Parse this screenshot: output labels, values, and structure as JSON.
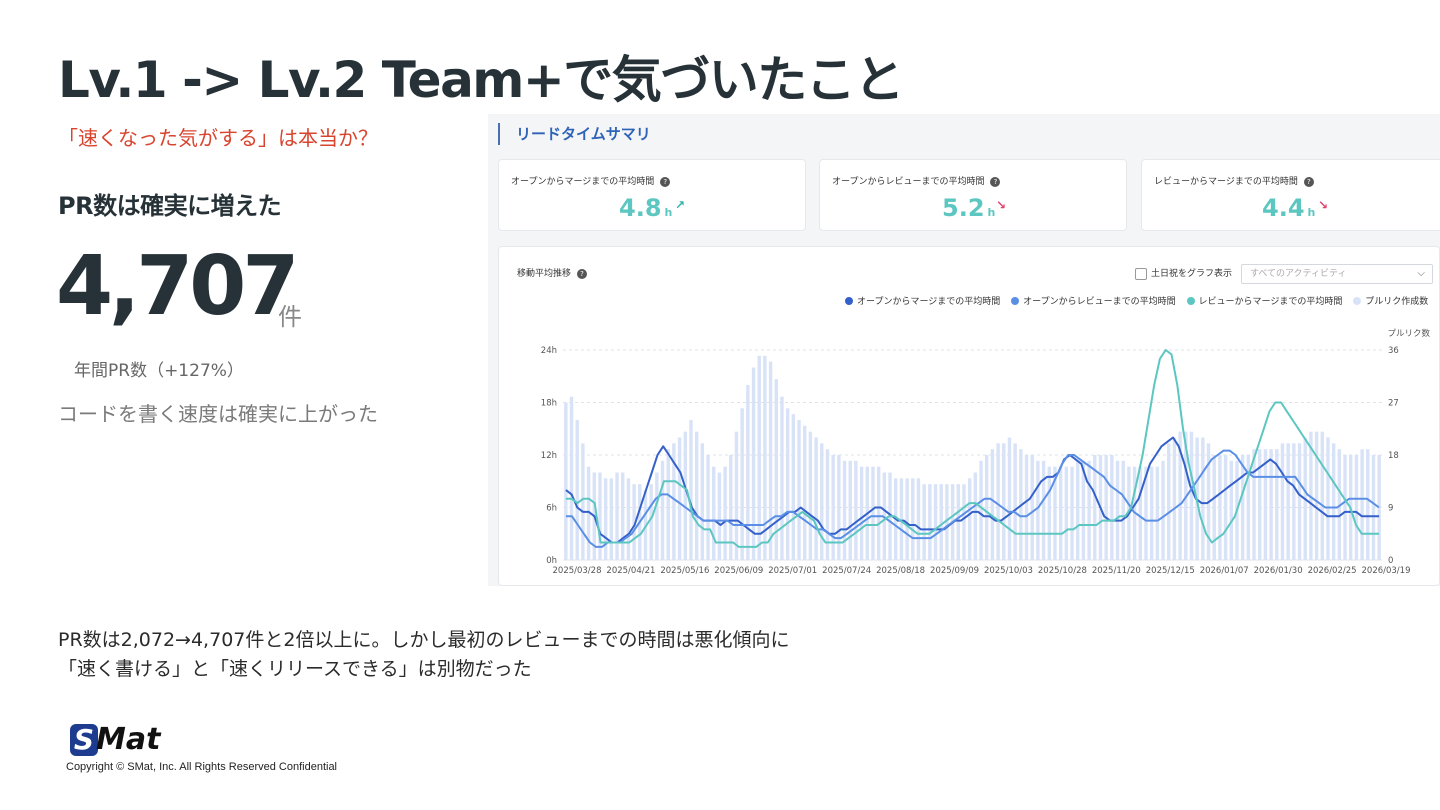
{
  "slide": {
    "title": "Lv.1 -> Lv.2 Team+で気づいたこと",
    "subtitle": "「速くなった気がする」は本当か？",
    "pr_heading": "PR数は確実に増えた",
    "pr_count": "4,707",
    "pr_unit": "件",
    "pr_caption": "年間PR数（+127%）",
    "speed_note": "コードを書く速度は確実に上がった",
    "footnote_line1": "PR数は2,072→4,707件と2倍以上に。しかし最初のレビューまでの時間は悪化傾向に",
    "footnote_line2": "「速く書ける」と「速くリリースできる」は別物だった",
    "logo": "SMat",
    "copyright": "Copyright © SMat, Inc. All Rights Reserved Confidential"
  },
  "dashboard": {
    "panel_title": "リードタイムサマリ",
    "help_icon": "?",
    "metrics": [
      {
        "label": "オープンからマージまでの平均時間",
        "value": "4.8",
        "unit": "h",
        "trend": "↗",
        "trend_color": "#2fb3a8"
      },
      {
        "label": "オープンからレビューまでの平均時間",
        "value": "5.2",
        "unit": "h",
        "trend": "↘",
        "trend_color": "#e0436f"
      },
      {
        "label": "レビューからマージまでの平均時間",
        "value": "4.4",
        "unit": "h",
        "trend": "↘",
        "trend_color": "#e0436f"
      }
    ],
    "chart_title": "移動平均推移",
    "holiday_toggle_label": "土日祝をグラフ表示",
    "activity_select_value": "すべてのアクティビティ",
    "legend": [
      {
        "name": "オープンからマージまでの平均時間",
        "color": "#3460c9"
      },
      {
        "name": "オープンからレビューまでの平均時間",
        "color": "#5b8fe6"
      },
      {
        "name": "レビューからマージまでの平均時間",
        "color": "#5cc6c0"
      },
      {
        "name": "プルリク作成数",
        "color": "#d9e3f7"
      }
    ]
  },
  "chart_data": {
    "type": "line",
    "y_left_ticks": [
      "0h",
      "6h",
      "12h",
      "18h",
      "24h"
    ],
    "y_left_range": [
      0,
      24
    ],
    "y_right_label": "プルリク数",
    "y_right_ticks": [
      "0",
      "9",
      "18",
      "27",
      "36"
    ],
    "y_right_range": [
      0,
      36
    ],
    "x_tick_labels": [
      "2025/03/28",
      "2025/04/21",
      "2025/05/16",
      "2025/06/09",
      "2025/07/01",
      "2025/07/24",
      "2025/08/18",
      "2025/09/09",
      "2025/10/03",
      "2025/10/28",
      "2025/11/20",
      "2025/12/15",
      "2026/01/07",
      "2026/01/30",
      "2026/02/25",
      "2026/03/19"
    ],
    "grid": true,
    "bar_series": {
      "name": "プルリク作成数",
      "color": "#d9e3f7",
      "axis": "right",
      "values": [
        27,
        28,
        24,
        20,
        16,
        15,
        15,
        14,
        14,
        15,
        15,
        14,
        13,
        13,
        12,
        13,
        15,
        17,
        19,
        20,
        21,
        22,
        24,
        22,
        20,
        18,
        16,
        15,
        16,
        18,
        22,
        26,
        30,
        33,
        35,
        35,
        34,
        31,
        28,
        26,
        25,
        24,
        23,
        22,
        21,
        20,
        19,
        18,
        18,
        17,
        17,
        17,
        16,
        16,
        16,
        16,
        15,
        15,
        14,
        14,
        14,
        14,
        14,
        13,
        13,
        13,
        13,
        13,
        13,
        13,
        13,
        14,
        15,
        17,
        18,
        19,
        20,
        20,
        21,
        20,
        19,
        18,
        18,
        17,
        17,
        16,
        16,
        16,
        16,
        16,
        17,
        17,
        17,
        18,
        18,
        18,
        18,
        17,
        17,
        16,
        16,
        16,
        16,
        16,
        16,
        17,
        20,
        21,
        22,
        22,
        22,
        21,
        21,
        20,
        18,
        18,
        18,
        17,
        17,
        18,
        18,
        19,
        19,
        19,
        19,
        19,
        20,
        20,
        20,
        20,
        21,
        22,
        22,
        22,
        21,
        20,
        19,
        18,
        18,
        18,
        19,
        19,
        18,
        18
      ]
    },
    "series": [
      {
        "name": "オープンからマージまでの平均時間",
        "color": "#3460c9",
        "axis": "left",
        "values": [
          8,
          7.5,
          6,
          5.5,
          5.5,
          5,
          3,
          2.5,
          2,
          2,
          2.5,
          3,
          4,
          6,
          8,
          10,
          12,
          13,
          12,
          11,
          10,
          8,
          6,
          5,
          4.5,
          4.5,
          4.5,
          4,
          4.5,
          4.5,
          4.5,
          4,
          3.5,
          3,
          3,
          3.5,
          4,
          4.5,
          5,
          5.5,
          5.5,
          6,
          5.5,
          5,
          4.5,
          3.5,
          3,
          3,
          3.5,
          3.5,
          4,
          4.5,
          5,
          5.5,
          6,
          6,
          5.5,
          5,
          4.5,
          4.5,
          4,
          4,
          3.5,
          3.5,
          3.5,
          3.5,
          3.5,
          4,
          4.5,
          4.5,
          5,
          5.5,
          5.5,
          5,
          5,
          4.5,
          4.5,
          5,
          5.5,
          6,
          6.5,
          7,
          8,
          9,
          9.5,
          9.5,
          10,
          11.5,
          12,
          11.5,
          11,
          9,
          8,
          6.5,
          5,
          4.5,
          4.5,
          4.5,
          5,
          6,
          7,
          9,
          11,
          12,
          13,
          13.5,
          14,
          13,
          11,
          8.5,
          7,
          6.5,
          6.5,
          7,
          7.5,
          8,
          8.5,
          9,
          9.5,
          10,
          10,
          10.5,
          11,
          11.5,
          11,
          10,
          9,
          8.5,
          7.5,
          7,
          6.5,
          6,
          5.5,
          5,
          5,
          5,
          5.5,
          5.5,
          5.5,
          5,
          5,
          5,
          5
        ]
      },
      {
        "name": "オープンからレビューまでの平均時間",
        "color": "#5b8fe6",
        "axis": "left",
        "values": [
          5,
          5,
          4,
          3,
          2,
          1.5,
          1.5,
          2,
          2,
          2,
          2.5,
          3,
          4,
          5,
          6,
          7,
          7.5,
          7.5,
          7,
          6.5,
          6,
          5.5,
          5,
          4.5,
          4.5,
          4.5,
          4.5,
          4.5,
          4,
          4,
          4,
          4,
          4,
          4,
          4.5,
          5,
          5,
          5.5,
          5.5,
          5,
          4.5,
          4,
          3.5,
          3.5,
          3,
          2.5,
          2.5,
          3,
          3.5,
          4,
          4.5,
          5,
          5,
          5,
          4.5,
          4,
          3.5,
          3,
          2.5,
          2.5,
          2.5,
          2.5,
          3,
          3.5,
          4,
          4.5,
          5,
          5.5,
          6,
          6.5,
          7,
          7,
          6.5,
          6,
          5.5,
          5.5,
          5,
          5,
          5.5,
          6,
          7,
          8,
          9.5,
          11,
          12,
          12,
          11.5,
          11,
          10.5,
          10,
          9.5,
          8.5,
          8,
          7.5,
          6.5,
          5.5,
          5,
          4.5,
          4.5,
          4.5,
          5,
          5.5,
          6,
          6.5,
          7.5,
          8.5,
          9.5,
          10.5,
          11.5,
          12,
          12.5,
          12.5,
          12,
          11,
          10,
          9.5,
          9.5,
          9.5,
          9.5,
          9.5,
          9.5,
          9.5,
          9.5,
          8.5,
          7.5,
          7,
          6.5,
          6,
          6,
          6,
          6.5,
          7,
          7,
          7,
          7,
          6.5,
          6
        ]
      },
      {
        "name": "レビューからマージまでの平均時間",
        "color": "#5cc6c0",
        "axis": "left",
        "values": [
          7,
          7,
          6.5,
          7,
          7,
          6.5,
          2,
          2,
          2,
          2,
          2,
          2,
          2.5,
          3,
          4,
          5,
          7,
          9,
          9,
          9,
          8.5,
          8,
          5,
          4,
          3.5,
          3.5,
          2,
          2,
          2,
          2,
          1.5,
          1.5,
          1.5,
          1.5,
          2,
          2,
          3,
          3.5,
          4,
          4.5,
          5,
          5.5,
          5,
          4.5,
          3,
          2,
          2,
          2,
          2,
          2.5,
          3,
          3.5,
          4,
          4,
          4,
          4.5,
          5,
          5,
          4.5,
          4,
          3.5,
          3,
          3,
          3,
          3.5,
          4,
          4.5,
          5,
          5.5,
          6,
          6.5,
          6.5,
          6,
          5.5,
          5,
          4.5,
          4,
          3.5,
          3,
          3,
          3,
          3,
          3,
          3,
          3,
          3,
          3,
          3.5,
          3.5,
          4,
          4,
          4,
          4,
          4.5,
          4.5,
          4.5,
          5,
          5,
          6,
          9,
          12,
          16,
          20,
          23,
          24,
          23.5,
          20,
          15,
          11,
          8,
          5,
          3,
          2,
          2.5,
          3,
          4,
          5,
          7,
          9,
          11,
          13,
          15,
          17,
          18,
          18,
          17,
          16,
          15,
          14,
          13,
          12,
          11,
          10,
          9,
          8,
          7,
          6,
          4,
          3,
          3,
          3,
          3
        ]
      }
    ]
  }
}
